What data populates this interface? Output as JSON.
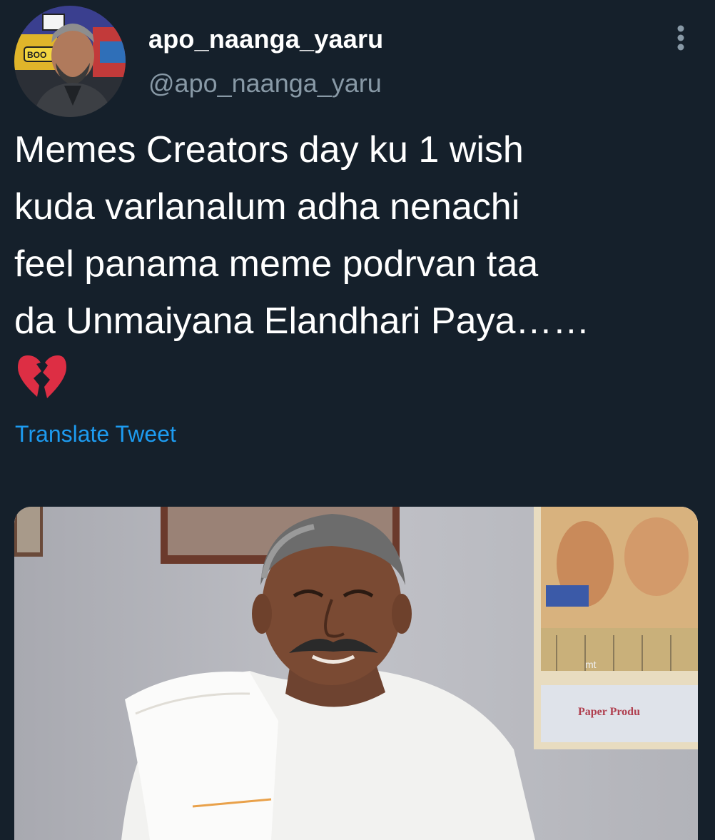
{
  "author": {
    "display_name": "apo_naanga_yaaru",
    "handle": "@apo_naanga_yaru",
    "avatar_icon": "avatar-image"
  },
  "tweet": {
    "text_lines": [
      "Memes Creators day ku 1 wish",
      "kuda varlanalum adha nenachi",
      "feel panama meme podrvan taa",
      "da Unmaiyana Elandhari Paya……"
    ],
    "emoji": "broken-heart-icon",
    "translate_label": "Translate Tweet"
  },
  "media": {
    "overlay_texts": [
      "mt",
      "Paper Produ"
    ]
  },
  "colors": {
    "background": "#15202b",
    "text_primary": "#ffffff",
    "text_secondary": "#8899a6",
    "accent": "#1d9bf0",
    "broken_heart": "#e0245e"
  },
  "icons": {
    "more": "more-vertical-icon"
  }
}
